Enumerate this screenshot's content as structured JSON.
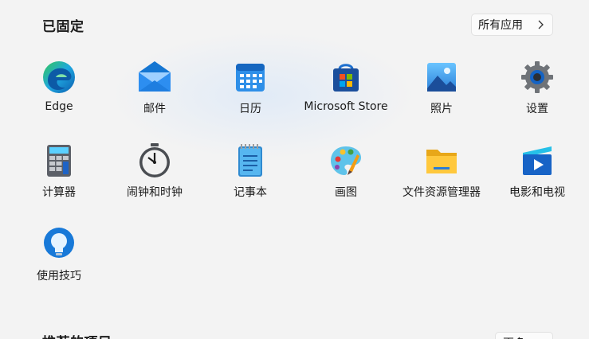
{
  "pinned": {
    "title": "已固定",
    "all_apps_label": "所有应用"
  },
  "apps": [
    {
      "label": "Edge"
    },
    {
      "label": "邮件"
    },
    {
      "label": "日历"
    },
    {
      "label": "Microsoft Store"
    },
    {
      "label": "照片"
    },
    {
      "label": "设置"
    },
    {
      "label": "计算器"
    },
    {
      "label": "闹钟和时钟"
    },
    {
      "label": "记事本"
    },
    {
      "label": "画图"
    },
    {
      "label": "文件资源管理器"
    },
    {
      "label": "电影和电视"
    },
    {
      "label": "使用技巧"
    }
  ],
  "recommended": {
    "title": "推荐的项目",
    "more_label": "更多"
  },
  "icons": {
    "all_apps_chevron": "chevron-right-icon"
  }
}
